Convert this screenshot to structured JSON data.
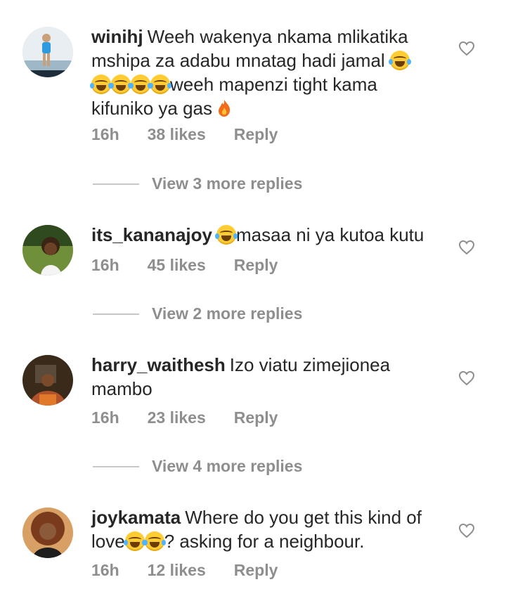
{
  "comments": [
    {
      "username": "winihj",
      "parts": [
        "Weeh wakenya nkama mlikatika mshipa za adabu mnatag hadi jamal ",
        "weeh mapenzi tight kama kifuniko ya gas "
      ],
      "time": "16h",
      "likes": "38 likes",
      "reply": "Reply",
      "more_replies": "View 3 more replies",
      "avatar_colors": [
        "#9fb8c8",
        "#e9eef2"
      ]
    },
    {
      "username": "its_kananajoy",
      "parts": [
        "masaa ni ya kutoa kutu"
      ],
      "time": "16h",
      "likes": "45 likes",
      "reply": "Reply",
      "more_replies": "View 2 more replies",
      "avatar_colors": [
        "#2f4a1e",
        "#6f8f3a"
      ]
    },
    {
      "username": "harry_waithesh",
      "parts": [
        "Izo viatu zimejionea mambo"
      ],
      "time": "16h",
      "likes": "23 likes",
      "reply": "Reply",
      "more_replies": "View 4 more replies",
      "avatar_colors": [
        "#3a2a1a",
        "#b0532a"
      ]
    },
    {
      "username": "joykamata",
      "parts": [
        "Where do you get this kind of love",
        "? asking for a neighbour."
      ],
      "time": "16h",
      "likes": "12 likes",
      "reply": "Reply",
      "avatar_colors": [
        "#7a3b1c",
        "#d9a066"
      ]
    }
  ],
  "colors": {
    "text": "#262626",
    "muted": "#8e8e8e",
    "divider": "#c7c7c7",
    "emoji": "#ffcc33"
  },
  "icons": {
    "like": "heart-outline-icon",
    "laugh": "tears-of-joy-emoji",
    "fire": "fire-emoji"
  }
}
